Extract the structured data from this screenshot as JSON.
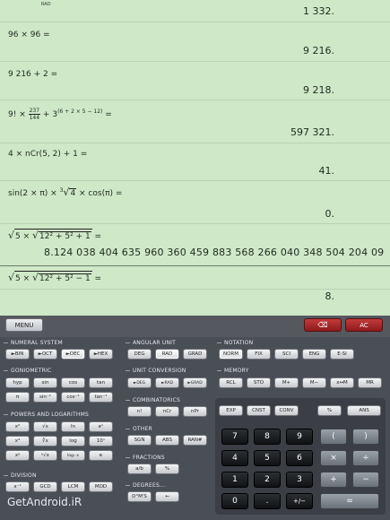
{
  "history": {
    "rad_tag": "RAD",
    "top_result": "1 332.",
    "entries": [
      {
        "expr": "96 × 96 =",
        "result": "9 216."
      },
      {
        "expr": "9 216 + 2 =",
        "result": "9 218."
      },
      {
        "expr_prefix": "9! × ",
        "frac_num": "237",
        "frac_den": "144",
        "expr_mid": " + 3",
        "expr_sup": "(6 + 2 × 5 − 12)",
        "expr_suffix": " =",
        "result": "597 321."
      },
      {
        "expr": "4 × nCr(5, 2) + 1 =",
        "result": "41."
      },
      {
        "expr_prefix": "sin(2 × π) × ",
        "root_index": "3",
        "root_body": "4",
        "expr_suffix": " × cos(π) =",
        "result": "0."
      },
      {
        "expr_prefix": "5 × ",
        "rad_inner": "12² + 5² + 1",
        "expr_suffix": " =",
        "result": "8.124 038 404 635 960 360 459 883 568 266 040 348 504 204 09"
      },
      {
        "expr_prefix": "5 × ",
        "rad_inner": "12² + 5² − 1",
        "expr_suffix": " =",
        "result": "8."
      }
    ]
  },
  "top_buttons": {
    "menu": "MENU",
    "backspace": "⌫",
    "ac": "AC"
  },
  "groups": {
    "numeral_system": {
      "label": "NUMERAL SYSTEM",
      "keys": [
        "►BIN",
        "►OCT",
        "►DEC",
        "►HEX"
      ]
    },
    "angular_unit": {
      "label": "ANGULAR UNIT",
      "keys": [
        "DEG",
        "RAD",
        "GRAD"
      ]
    },
    "notation": {
      "label": "NOTATION",
      "keys": [
        "NORM",
        "FIX",
        "SCI",
        "ENG",
        "E-SI"
      ]
    },
    "goniometric": {
      "label": "GONIOMETRIC",
      "keys": [
        "hyp",
        "sin",
        "cos",
        "tan",
        "π",
        "sin⁻¹",
        "cos⁻¹",
        "tan⁻¹"
      ]
    },
    "unit_conversion": {
      "label": "UNIT CONVERSION",
      "keys": [
        "►DEG",
        "►RAD",
        "►GRAD"
      ]
    },
    "memory": {
      "label": "MEMORY",
      "keys": [
        "RCL",
        "STO",
        "M+",
        "M−",
        "x↔M",
        "MR"
      ]
    },
    "combinatorics": {
      "label": "COMBINATORICS",
      "keys": [
        "n!",
        "nCr",
        "nPr"
      ]
    },
    "powers_log": {
      "label": "POWERS AND LOGARITHMS",
      "keys": [
        "x²",
        "√x",
        "ln",
        "eˣ",
        "x³",
        "∛x",
        "log",
        "10ˣ",
        "xʸ",
        "ʸ√x",
        "logₓ x",
        "e"
      ]
    },
    "other": {
      "label": "OTHER",
      "keys": [
        "SGN",
        "ABS",
        "RAN#"
      ]
    },
    "fractions": {
      "label": "FRACTIONS",
      "keys": [
        "a/b",
        "%"
      ]
    },
    "division": {
      "label": "DIVISION",
      "keys": [
        "x⁻¹",
        "GCD",
        "LCM",
        "MOD"
      ]
    },
    "degrees": {
      "label": "DEGREES...",
      "keys": [
        "D°M'S",
        "←"
      ]
    }
  },
  "function_row": {
    "keys": [
      "EXP",
      "CNST",
      "CONV",
      "%",
      "ANS"
    ]
  },
  "numpad": {
    "row1": [
      "7",
      "8",
      "9",
      "(",
      ")"
    ],
    "row2": [
      "4",
      "5",
      "6",
      "×",
      "÷"
    ],
    "row3": [
      "1",
      "2",
      "3",
      "+",
      "−"
    ],
    "row4": [
      "0",
      ".",
      "+/−",
      "="
    ]
  },
  "watermark": "GetAndroid.iR"
}
